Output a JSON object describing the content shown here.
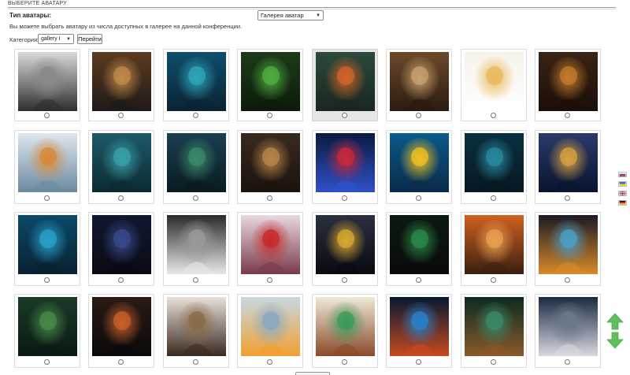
{
  "header": {
    "title": "ВЫБЕРИТЕ АВАТАРУ"
  },
  "avatar_type": {
    "label": "Тип аватары:",
    "selected": "Галерея аватар"
  },
  "info": {
    "text": "Вы можете выбрать аватару из числа доступных в галерее на данной конференции."
  },
  "category": {
    "label": "Категория:",
    "selected": "gallery I",
    "go_label": "Перейти"
  },
  "colors": {
    "accent_green": "#5fbf5f",
    "tile_selected_bg": "#e6e6e6",
    "divider": "#9a9a9a"
  },
  "gallery": {
    "rows": [
      [
        {
          "name": "robot-spider-avatar",
          "selected": false
        },
        {
          "name": "cat-with-fishbowl-avatar",
          "selected": false
        },
        {
          "name": "blue-creature-avatar",
          "selected": false
        },
        {
          "name": "green-frog-monster-avatar",
          "selected": false
        },
        {
          "name": "red-haired-girl-avatar",
          "selected": true
        },
        {
          "name": "library-scene-avatar",
          "selected": false
        },
        {
          "name": "fairy-girl-avatar",
          "selected": false
        },
        {
          "name": "dragon-at-laptop-avatar",
          "selected": false
        }
      ],
      [
        {
          "name": "cat-aquarium-avatar",
          "selected": false
        },
        {
          "name": "man-with-fish-avatar",
          "selected": false
        },
        {
          "name": "witch-fish-avatar",
          "selected": false
        },
        {
          "name": "woman-and-lion-avatar",
          "selected": false
        },
        {
          "name": "betta-fish-avatar",
          "selected": false
        },
        {
          "name": "angelfish-avatar",
          "selected": false
        },
        {
          "name": "woman-at-aquarium-avatar",
          "selected": false
        },
        {
          "name": "ornate-dragon-avatar",
          "selected": false
        }
      ],
      [
        {
          "name": "girls-at-aquarium-avatar",
          "selected": false
        },
        {
          "name": "wizard-avatar",
          "selected": false
        },
        {
          "name": "scientist-cat-avatar",
          "selected": false
        },
        {
          "name": "butterfly-blossom-avatar",
          "selected": false
        },
        {
          "name": "golden-deity-avatar",
          "selected": false
        },
        {
          "name": "meditating-aquarium-avatar",
          "selected": false
        },
        {
          "name": "fox-avatar",
          "selected": false
        },
        {
          "name": "fish-in-head-avatar",
          "selected": false
        }
      ],
      [
        {
          "name": "lizard-in-water-avatar",
          "selected": false
        },
        {
          "name": "monkey-avatar",
          "selected": false
        },
        {
          "name": "dragon-with-fish-avatar",
          "selected": false
        },
        {
          "name": "glass-head-fish-avatar",
          "selected": false
        },
        {
          "name": "green-dragon-tea-avatar",
          "selected": false
        },
        {
          "name": "jellyfish-avatar",
          "selected": false
        },
        {
          "name": "dragon-computer-avatar",
          "selected": false
        },
        {
          "name": "old-wizard-guitar-avatar",
          "selected": false
        }
      ]
    ]
  },
  "sidebar": {
    "flags": [
      "russia-flag-icon",
      "ukraine-flag-icon",
      "uk-flag-icon",
      "germany-flag-icon"
    ],
    "arrows": [
      "arrow-up-icon",
      "arrow-down-icon"
    ]
  }
}
